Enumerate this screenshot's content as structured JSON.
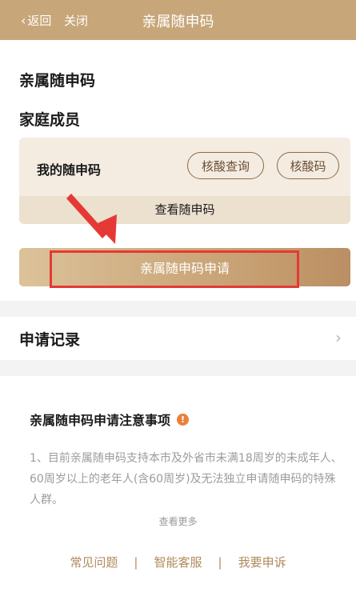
{
  "nav": {
    "back_label": "返回",
    "close_label": "关闭",
    "title": "亲属随申码"
  },
  "section": {
    "title": "亲属随申码",
    "family_title": "家庭成员"
  },
  "card": {
    "label": "我的随申码",
    "btn_nucleic_query": "核酸查询",
    "btn_nucleic": "核酸码",
    "view_code": "查看随申码"
  },
  "apply_button": "亲属随申码申请",
  "records": {
    "label": "申请记录"
  },
  "notice": {
    "title": "亲属随申码申请注意事项",
    "body": "1、目前亲属随申码支持本市及外省市未满18周岁的未成年人、60周岁以上的老年人(含60周岁)及无法独立申请随申码的特殊人群。",
    "more": "查看更多"
  },
  "links": {
    "faq": "常见问题",
    "service": "智能客服",
    "appeal": "我要申诉",
    "separator": "|"
  },
  "colors": {
    "brand": "#c7a679",
    "accent_text": "#b08a5c",
    "annotation_red": "#e53935",
    "warning": "#e8823a"
  }
}
